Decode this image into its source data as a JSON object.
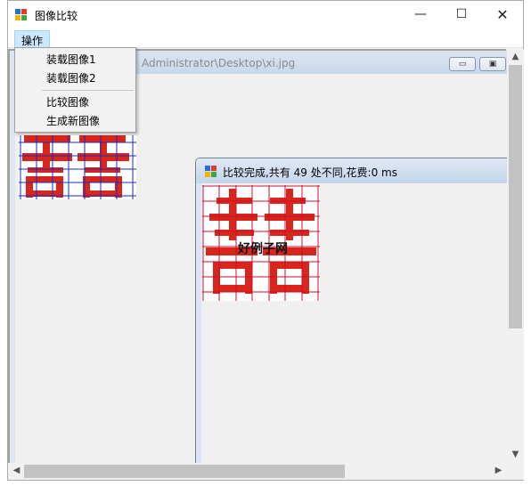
{
  "window": {
    "title": "图像比较",
    "min_glyph": "—",
    "max_glyph": "☐",
    "close_glyph": "✕"
  },
  "menu": {
    "top_label": "操作",
    "items": [
      {
        "label": "装载图像1"
      },
      {
        "label": "装载图像2"
      },
      {
        "label": "比较图像"
      },
      {
        "label": "生成新图像"
      }
    ]
  },
  "child1": {
    "title": "Administrator\\Desktop\\xi.jpg",
    "btn_min": "▭",
    "btn_restore": "▣"
  },
  "child2": {
    "title": "比较完成,共有 49 处不同,花费:0 ms",
    "watermark": "好例子网"
  },
  "scroll": {
    "up": "▲",
    "down": "▼",
    "left": "◀",
    "right": "▶"
  },
  "colors": {
    "char_red": "#d9261c",
    "grid_blue": "#1a2cb8",
    "grid_red": "#c8102e",
    "menu_highlight": "#cce8ff"
  }
}
